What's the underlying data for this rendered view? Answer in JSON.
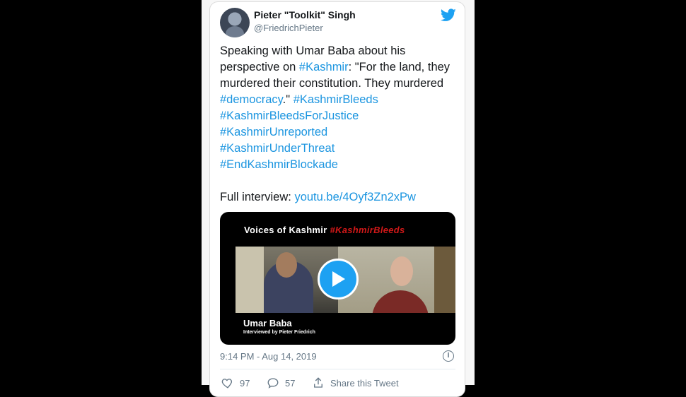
{
  "author": {
    "name": "Pieter \"Toolkit\" Singh",
    "handle": "@FriedrichPieter"
  },
  "tweet": {
    "p1": "Speaking with Umar Baba about his perspective on ",
    "tag_kashmir": "#Kashmir",
    "p2": ": \"For the land, they murdered their constitution. They murdered ",
    "tag_democracy": "#democracy",
    "p3": ".\" ",
    "tag_bleeds": "#KashmirBleeds",
    "tag_justice": "#KashmirBleedsForJustice",
    "tag_unreported": "#KashmirUnreported",
    "tag_threat": "#KashmirUnderThreat",
    "tag_blockade": "#EndKashmirBlockade",
    "interview_label": "Full interview: ",
    "interview_link": "youtu.be/4Oyf3Zn2xPw"
  },
  "video": {
    "title": "Voices of Kashmir",
    "title_tag": "#KashmirBleeds",
    "name": "Umar Baba",
    "subtitle": "Interviewed by Pieter Friedrich"
  },
  "timestamp": "9:14 PM - Aug 14, 2019",
  "actions": {
    "likes": "97",
    "replies": "57",
    "share": "Share this Tweet"
  },
  "colors": {
    "link": "#1b95e0",
    "text": "#14171a",
    "muted": "#657786",
    "twitter_blue": "#1da1f2"
  }
}
